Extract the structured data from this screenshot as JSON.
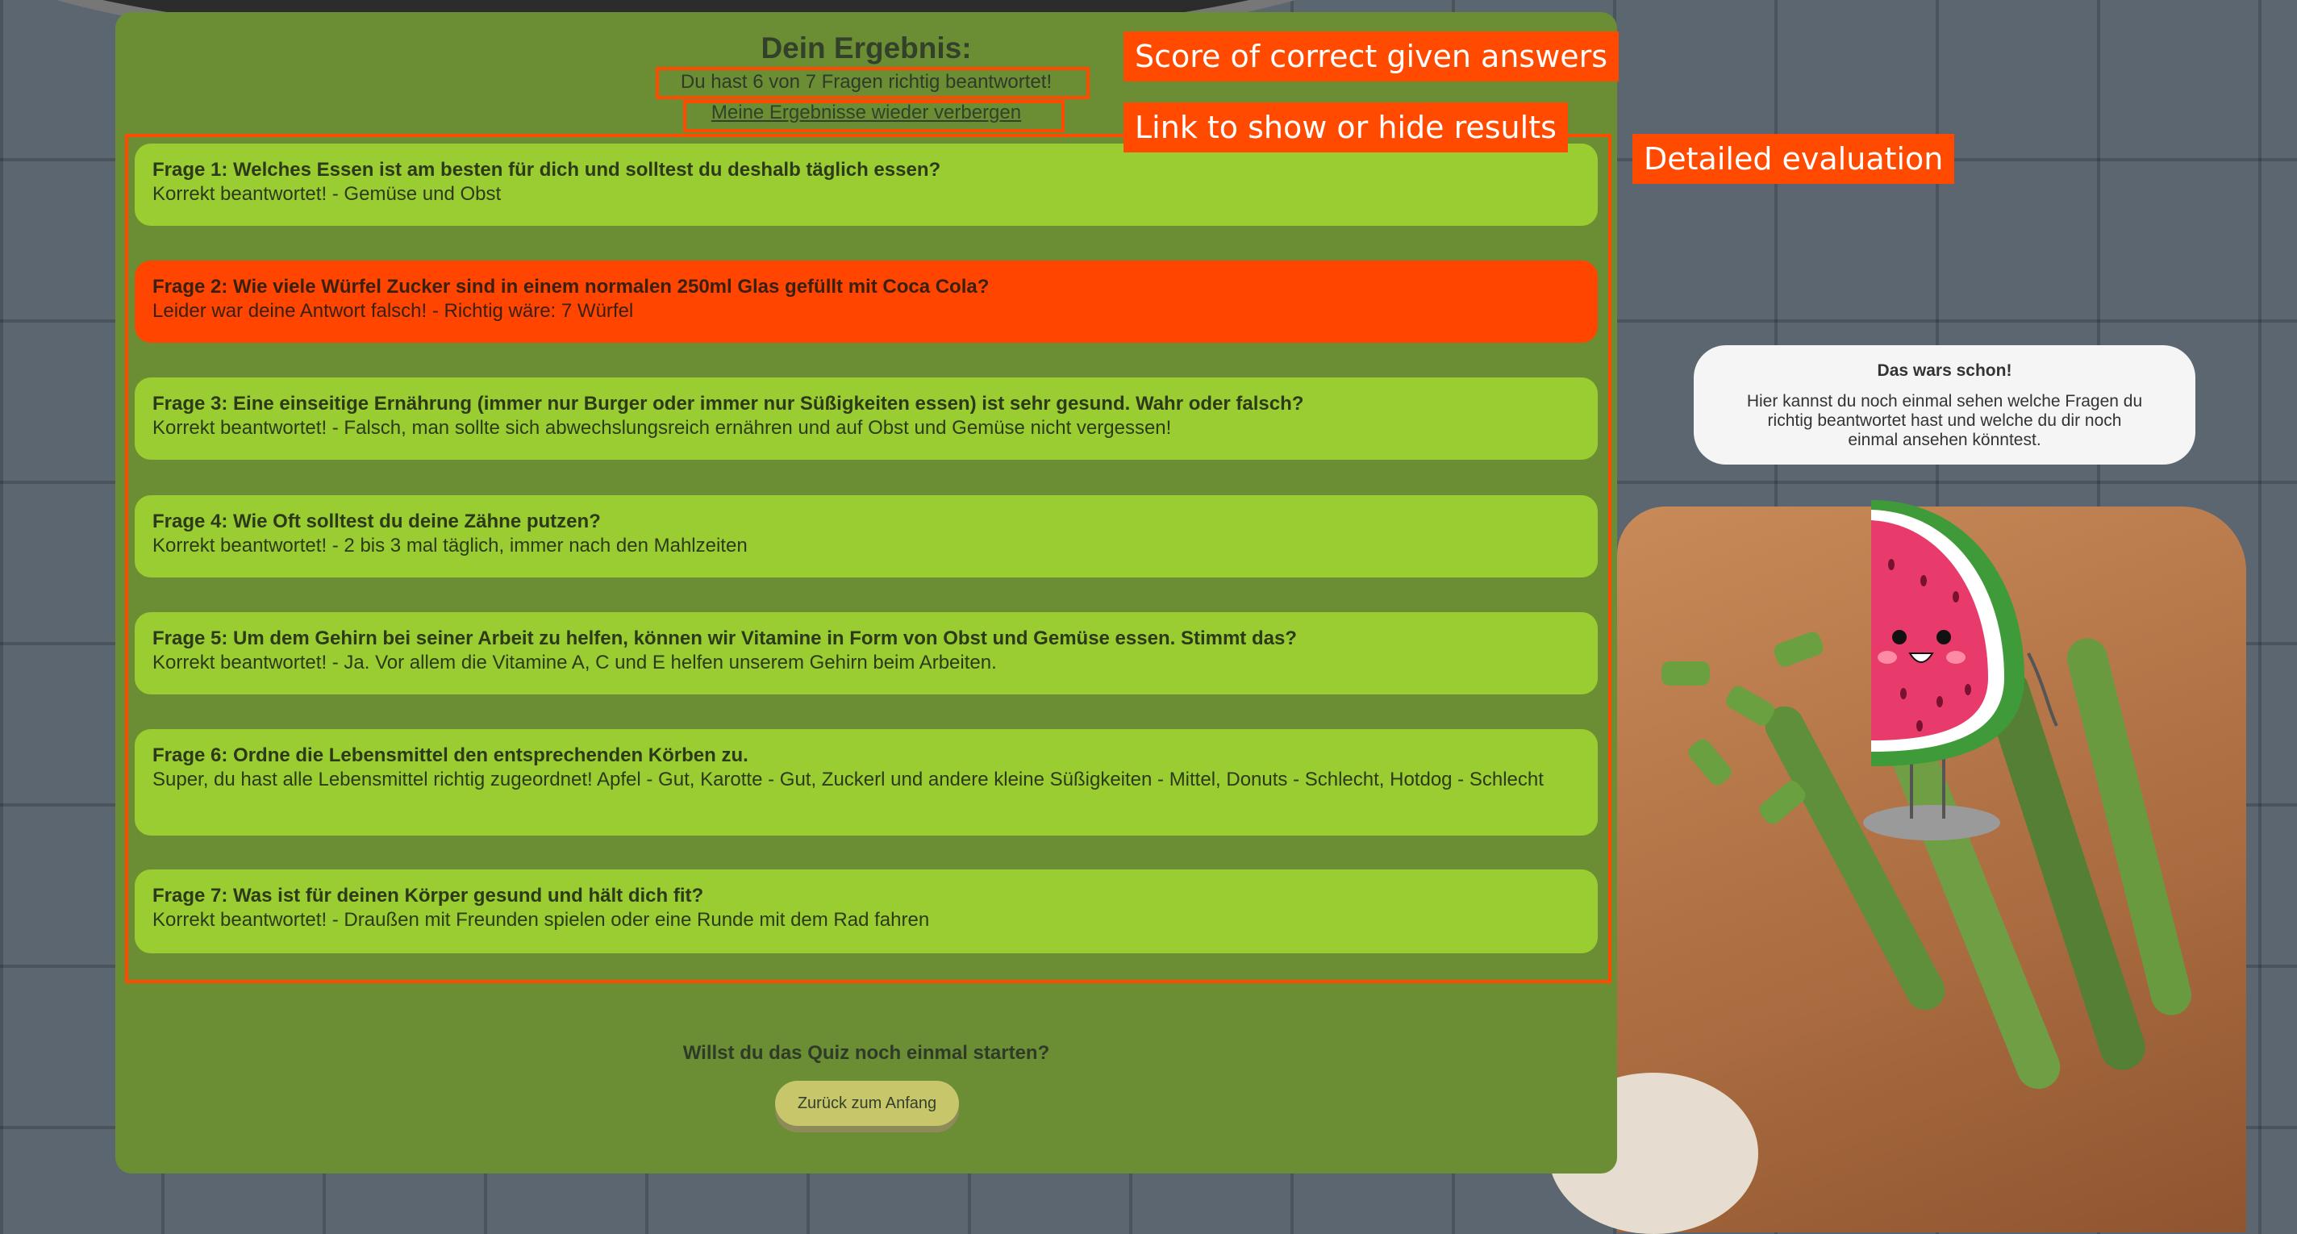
{
  "result": {
    "title": "Dein Ergebnis:",
    "score_text": "Du hast 6 von 7 Fragen richtig beantwortet!",
    "toggle_link": "Meine Ergebnisse wieder verbergen"
  },
  "questions": [
    {
      "question": "Frage 1: Welches Essen ist am besten für dich und solltest du deshalb täglich essen?",
      "answer": "Korrekt beantwortet! - Gemüse und Obst",
      "correct": true
    },
    {
      "question": "Frage 2: Wie viele Würfel Zucker sind in einem normalen 250ml Glas gefüllt mit Coca Cola?",
      "answer": "Leider war deine Antwort falsch! - Richtig wäre: 7 Würfel",
      "correct": false
    },
    {
      "question": "Frage 3: Eine einseitige Ernährung (immer nur Burger oder immer nur Süßigkeiten essen) ist sehr gesund. Wahr oder falsch?",
      "answer": "Korrekt beantwortet! - Falsch, man sollte sich abwechslungsreich ernähren und auf Obst und Gemüse nicht vergessen!",
      "correct": true
    },
    {
      "question": "Frage 4: Wie Oft solltest du deine Zähne putzen?",
      "answer": "Korrekt beantwortet! - 2 bis 3 mal täglich, immer nach den Mahlzeiten",
      "correct": true
    },
    {
      "question": "Frage 5: Um dem Gehirn bei seiner Arbeit zu helfen, können wir Vitamine in Form von Obst und Gemüse essen. Stimmt das?",
      "answer": "Korrekt beantwortet! - Ja. Vor allem die Vitamine A, C und E helfen unserem Gehirn beim Arbeiten.",
      "correct": true
    },
    {
      "question": "Frage 6: Ordne die Lebensmittel den entsprechenden Körben zu.",
      "answer": "Super, du hast alle Lebensmittel richtig zugeordnet! Apfel - Gut, Karotte - Gut, Zuckerl und andere kleine Süßigkeiten - Mittel, Donuts - Schlecht, Hotdog - Schlecht",
      "correct": true
    },
    {
      "question": "Frage 7: Was ist für deinen Körper gesund und hält dich fit?",
      "answer": "Korrekt beantwortet! - Draußen mit Freunden spielen oder eine Runde mit dem Rad fahren",
      "correct": true
    }
  ],
  "restart": {
    "question": "Willst du das Quiz noch einmal starten?",
    "button": "Zurück zum Anfang"
  },
  "annotations": {
    "score": "Score of correct given answers",
    "link": "Link to show or hide results",
    "evaluation": "Detailed evaluation"
  },
  "bubble": {
    "title": "Das wars schon!",
    "text": "Hier kannst du noch einmal sehen welche Fragen du richtig beantwortet hast und welche du dir noch einmal ansehen könntest."
  },
  "colors": {
    "panel": "#6b8e34",
    "correct": "#9acd32",
    "wrong": "#ff4500",
    "annotation": "#ff4a00"
  }
}
